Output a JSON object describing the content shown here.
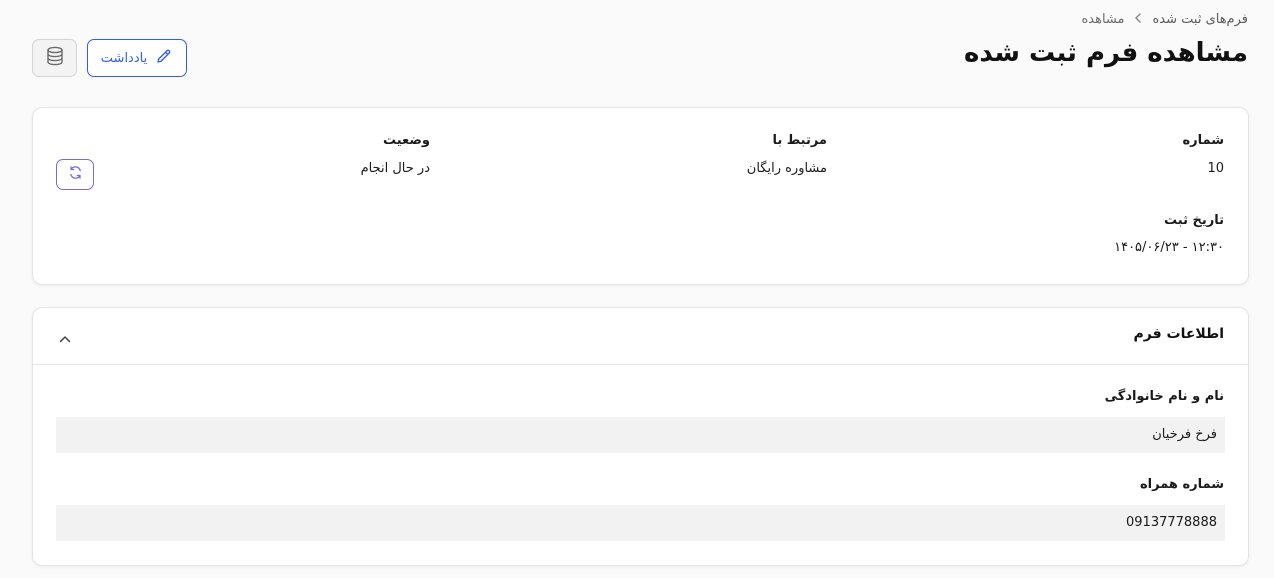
{
  "breadcrumb": {
    "parent": "فرم‌های ثبت شده",
    "current": "مشاهده"
  },
  "page": {
    "title": "مشاهده فرم ثبت شده"
  },
  "toolbar": {
    "note_label": "یادداشت"
  },
  "summary": {
    "number_label": "شماره",
    "number_value": "10",
    "related_label": "مرتبط با",
    "related_value": "مشاوره رایگان",
    "status_label": "وضعیت",
    "status_value": "در حال انجام",
    "date_label": "تاریخ ثبت",
    "date_value": "۱۴۰۵/۰۶/۲۳ - ۱۲:۳۰"
  },
  "form_info": {
    "title": "اطلاعات فرم",
    "fields": [
      {
        "label": "نام و نام خانوادگی",
        "value": "فرخ فرخیان"
      },
      {
        "label": "شماره همراه",
        "value": "09137778888"
      }
    ]
  },
  "colors": {
    "accent": "#2f5fe8",
    "refresh": "#7a6bd8"
  },
  "icons": [
    "chevron-left-icon",
    "pencil-icon",
    "database-icon",
    "refresh-icon",
    "chevron-up-icon"
  ]
}
